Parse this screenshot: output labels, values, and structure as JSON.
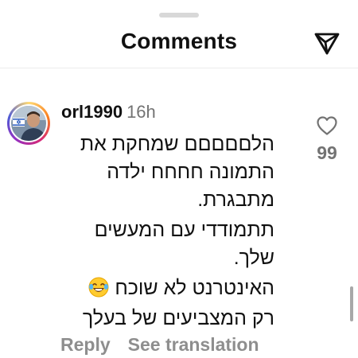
{
  "header": {
    "title": "Comments",
    "share_icon": "send-paper-plane-icon"
  },
  "comment": {
    "username": "orl1990",
    "time": "16h",
    "avatar_icon": "profile-avatar-with-israel-flag",
    "text_paragraphs": [
      "הלםםםםם שמחקת את התמונה חחחח ילדה מתבגרת.",
      "תתמודדי עם המעשים שלך.",
      "האינטרנט לא שוכח",
      "רק המצביעים של בעלך"
    ],
    "emoji": "face-with-tears-of-joy-emoji",
    "like_icon": "heart-outline-icon",
    "like_count": "99",
    "reply_label": "Reply",
    "translate_label": "See translation"
  },
  "colors": {
    "primary_text": "#111111",
    "secondary_text": "#737373",
    "action_text": "#8e8e8e",
    "story_ring": [
      "#feda75",
      "#fa7e1e",
      "#d62976",
      "#962fbf",
      "#4f5bd5"
    ]
  }
}
